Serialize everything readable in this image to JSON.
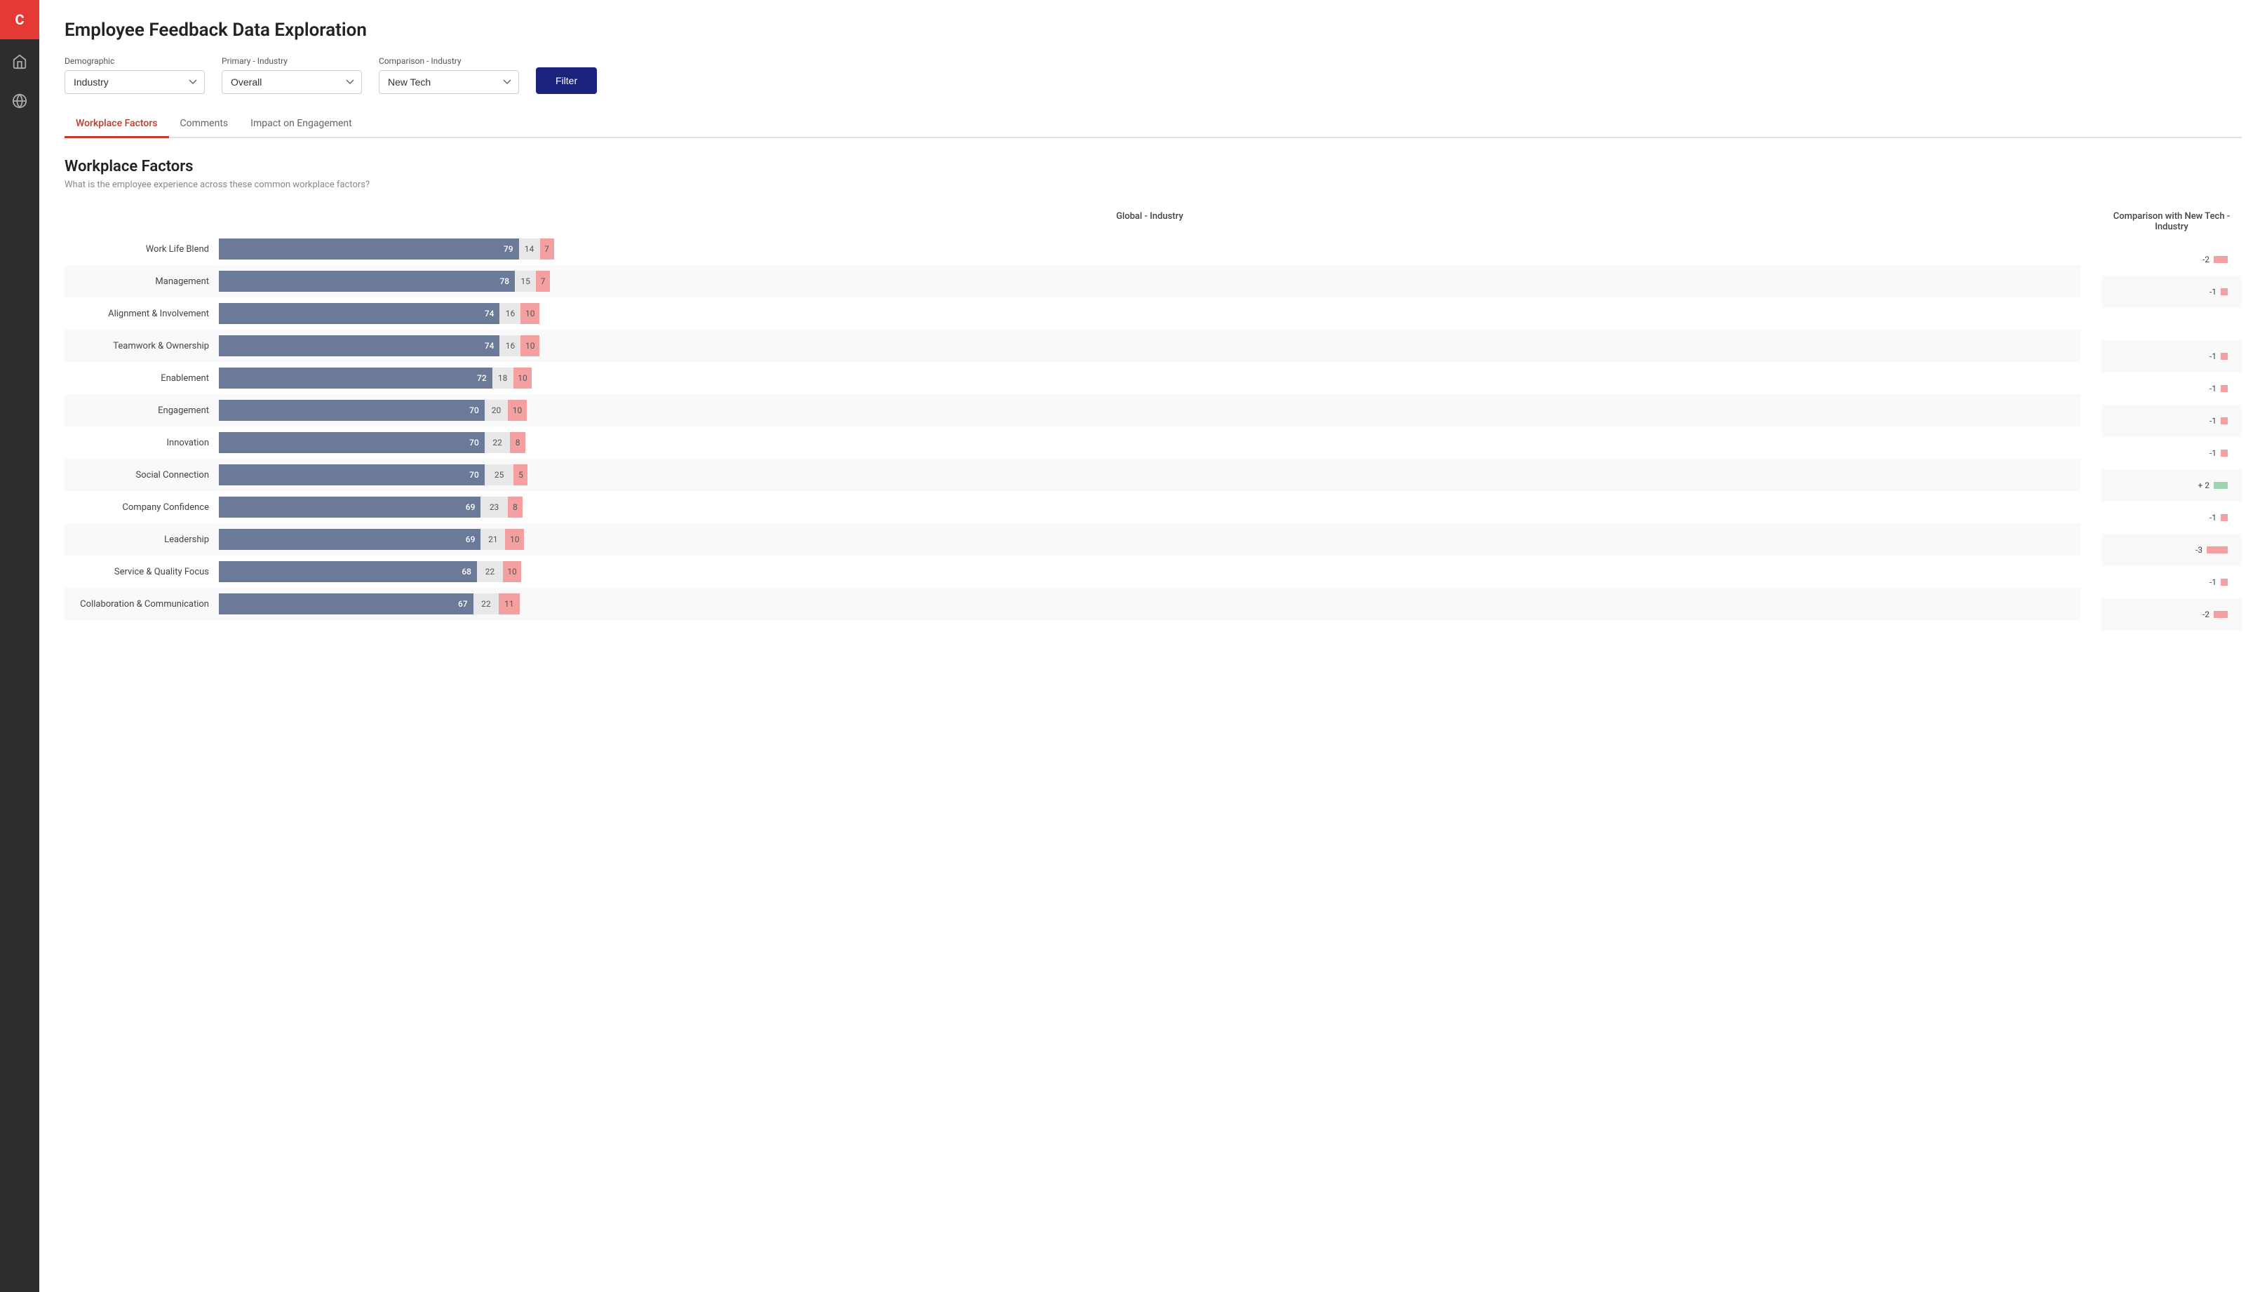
{
  "app": {
    "logo": "C",
    "title": "Employee Feedback Data Exploration"
  },
  "filters": {
    "demographic_label": "Demographic",
    "demographic_value": "Industry",
    "primary_label": "Primary - Industry",
    "primary_value": "Overall",
    "comparison_label": "Comparison - Industry",
    "comparison_value": "New Tech",
    "filter_button": "Filter"
  },
  "tabs": [
    {
      "label": "Workplace Factors",
      "active": true
    },
    {
      "label": "Comments",
      "active": false
    },
    {
      "label": "Impact on Engagement",
      "active": false
    }
  ],
  "section": {
    "title": "Workplace Factors",
    "subtitle": "What is the employee experience across these common workplace factors?"
  },
  "chart": {
    "main_header": "Global - Industry",
    "comparison_header": "Comparison with New Tech - Industry",
    "rows": [
      {
        "label": "Work Life Blend",
        "blue": 79,
        "neutral": 14,
        "red": 7,
        "comp": -2,
        "comp_type": "neg"
      },
      {
        "label": "Management",
        "blue": 78,
        "neutral": 15,
        "red": 7,
        "comp": -1,
        "comp_type": "neg"
      },
      {
        "label": "Alignment & Involvement",
        "blue": 74,
        "neutral": 16,
        "red": 10,
        "comp": 0,
        "comp_type": "none"
      },
      {
        "label": "Teamwork & Ownership",
        "blue": 74,
        "neutral": 16,
        "red": 10,
        "comp": -1,
        "comp_type": "neg"
      },
      {
        "label": "Enablement",
        "blue": 72,
        "neutral": 18,
        "red": 10,
        "comp": -1,
        "comp_type": "neg"
      },
      {
        "label": "Engagement",
        "blue": 70,
        "neutral": 20,
        "red": 10,
        "comp": -1,
        "comp_type": "neg"
      },
      {
        "label": "Innovation",
        "blue": 70,
        "neutral": 22,
        "red": 8,
        "comp": -1,
        "comp_type": "neg"
      },
      {
        "label": "Social Connection",
        "blue": 70,
        "neutral": 25,
        "red": 5,
        "comp": 2,
        "comp_type": "pos"
      },
      {
        "label": "Company Confidence",
        "blue": 69,
        "neutral": 23,
        "red": 8,
        "comp": -1,
        "comp_type": "neg"
      },
      {
        "label": "Leadership",
        "blue": 69,
        "neutral": 21,
        "red": 10,
        "comp": -3,
        "comp_type": "neg"
      },
      {
        "label": "Service & Quality Focus",
        "blue": 68,
        "neutral": 22,
        "red": 10,
        "comp": -1,
        "comp_type": "neg"
      },
      {
        "label": "Collaboration & Communication",
        "blue": 67,
        "neutral": 22,
        "red": 11,
        "comp": -2,
        "comp_type": "neg"
      }
    ]
  }
}
